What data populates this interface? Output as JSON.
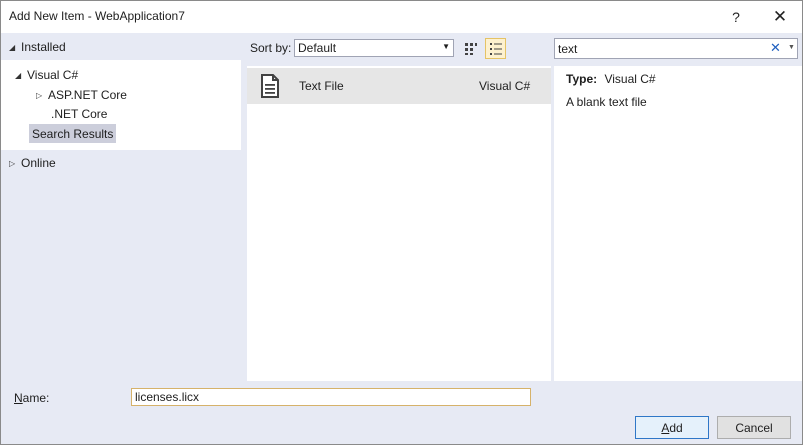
{
  "window": {
    "title": "Add New Item - WebApplication7",
    "help_label": "?",
    "close_label": "✕"
  },
  "tree": {
    "installed": "Installed",
    "visual_csharp": "Visual C#",
    "aspnet_core": "ASP.NET Core",
    "net_core": ".NET Core",
    "search_results": "Search Results",
    "online": "Online"
  },
  "toolbar": {
    "sort_by_label": "Sort by:",
    "sort_value": "Default",
    "search_value": "text",
    "search_clear": "✕"
  },
  "templates": [
    {
      "name": "Text File",
      "language": "Visual C#",
      "icon": "text-file-icon"
    }
  ],
  "details": {
    "type_label": "Type:",
    "type_value": "Visual C#",
    "description": "A blank text file"
  },
  "footer": {
    "name_label_first": "N",
    "name_label_rest": "ame:",
    "name_value": "licenses.licx",
    "add_first": "A",
    "add_rest": "dd",
    "cancel_label": "Cancel"
  },
  "colors": {
    "selected_tree_bg": "#cccedb",
    "selected_item_bg": "#e6e6e6",
    "panel_bg": "#e7eaf4",
    "accent": "#2f77c7"
  }
}
